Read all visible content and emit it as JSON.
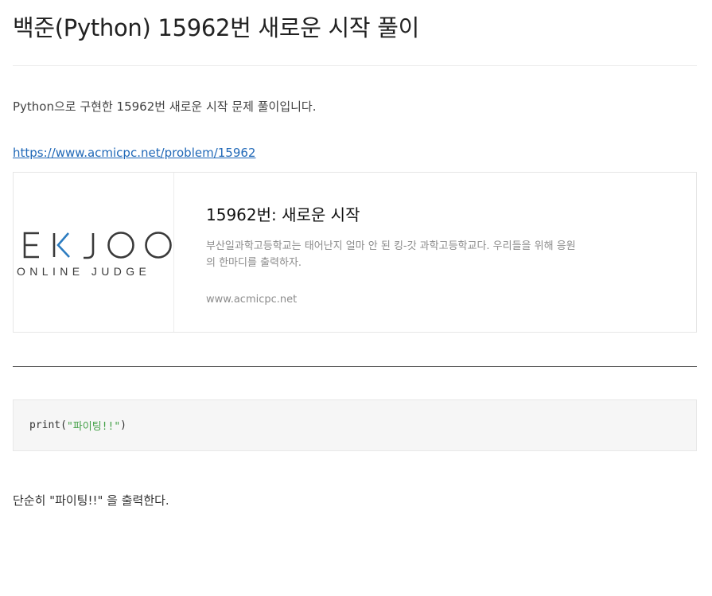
{
  "post": {
    "title": "백준(Python) 15962번 새로운 시작 풀이",
    "intro": "Python으로 구현한 15962번 새로운 시작 문제 풀이입니다.",
    "link": "https://www.acmicpc.net/problem/15962",
    "summary": "단순히 \"파이팅!!\" 을 출력한다."
  },
  "link_card": {
    "logo_text": "BAEKJOON",
    "logo_subtext": "ONLINE JUDGE",
    "title": "15962번: 새로운 시작",
    "description": "부산일과학고등학교는 태어난지 얼마 안 된 킹-갓 과학고등학교다. 우리들을 위해 응원의 한마디를 출력하자.",
    "domain": "www.acmicpc.net"
  },
  "code": {
    "fn": "print(",
    "str": "\"파이팅!!\"",
    "close": ")"
  },
  "colors": {
    "link": "#2169b8",
    "logo_accent": "#2c7cc0",
    "string": "#43a047"
  }
}
